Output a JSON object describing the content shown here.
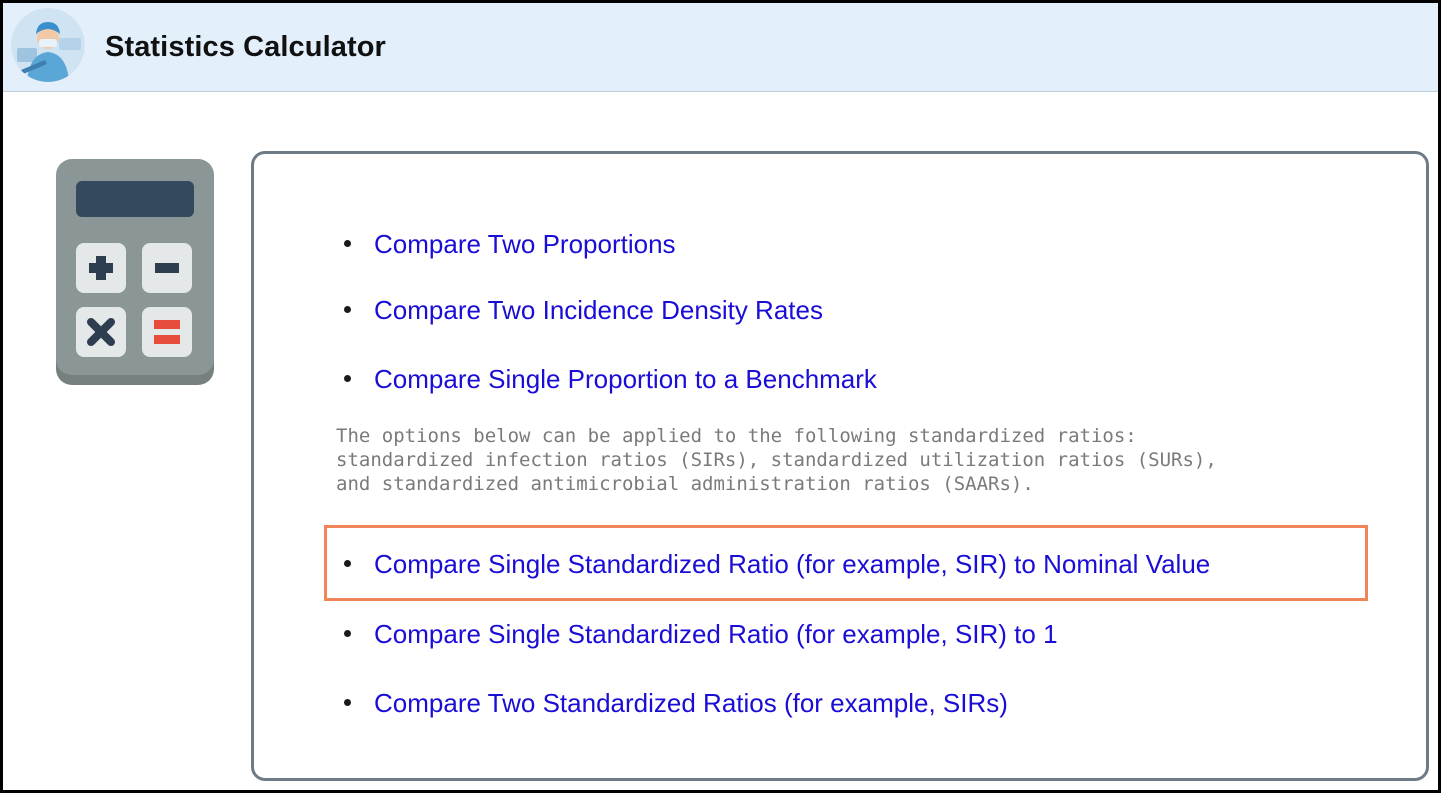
{
  "window": {
    "title": "Statistics Calculator"
  },
  "icons": {
    "avatar": "nurse-avatar-icon",
    "calculator": "calculator-icon"
  },
  "links": [
    {
      "label": "Compare Two Proportions"
    },
    {
      "label": "Compare Two Incidence Density Rates"
    },
    {
      "label": "Compare Single Proportion to a Benchmark"
    },
    {
      "label": "Compare Single Standardized Ratio (for example, SIR) to Nominal Value",
      "highlighted": true
    },
    {
      "label": "Compare Single Standardized Ratio (for example, SIR) to 1"
    },
    {
      "label": "Compare Two Standardized Ratios (for example, SIRs)"
    }
  ],
  "description": {
    "lines": [
      "The options below can be applied to the following standardized ratios:",
      "standardized infection ratios (SIRs), standardized utilization ratios (SURs),",
      "and standardized antimicrobial administration ratios (SAARs)."
    ]
  },
  "colors": {
    "link": "#1a0dd6",
    "titlebar": "#e3effb",
    "highlight_border": "#f0855a",
    "calculator_body": "#8b9696",
    "calculator_screen": "#34495e",
    "equals_red": "#e74c3c"
  }
}
